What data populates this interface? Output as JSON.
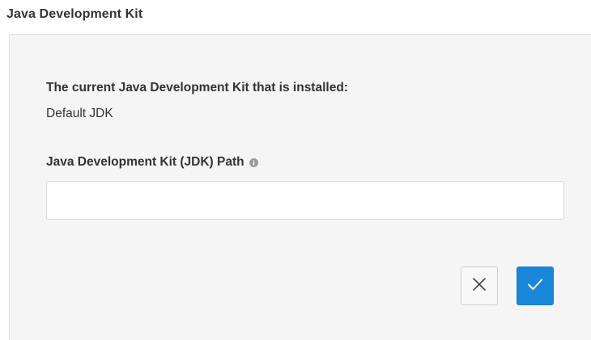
{
  "section": {
    "title": "Java Development Kit"
  },
  "installed": {
    "label": "The current Java Development Kit that is installed:",
    "value": "Default JDK"
  },
  "jdk_path": {
    "label": "Java Development Kit (JDK) Path",
    "info_icon": "info-icon",
    "value": "",
    "placeholder": ""
  },
  "actions": {
    "cancel_icon": "close-icon",
    "confirm_icon": "check-icon"
  },
  "colors": {
    "panel_background": "#f5f5f5",
    "confirm_button": "#1a86d9",
    "text": "#333333"
  }
}
